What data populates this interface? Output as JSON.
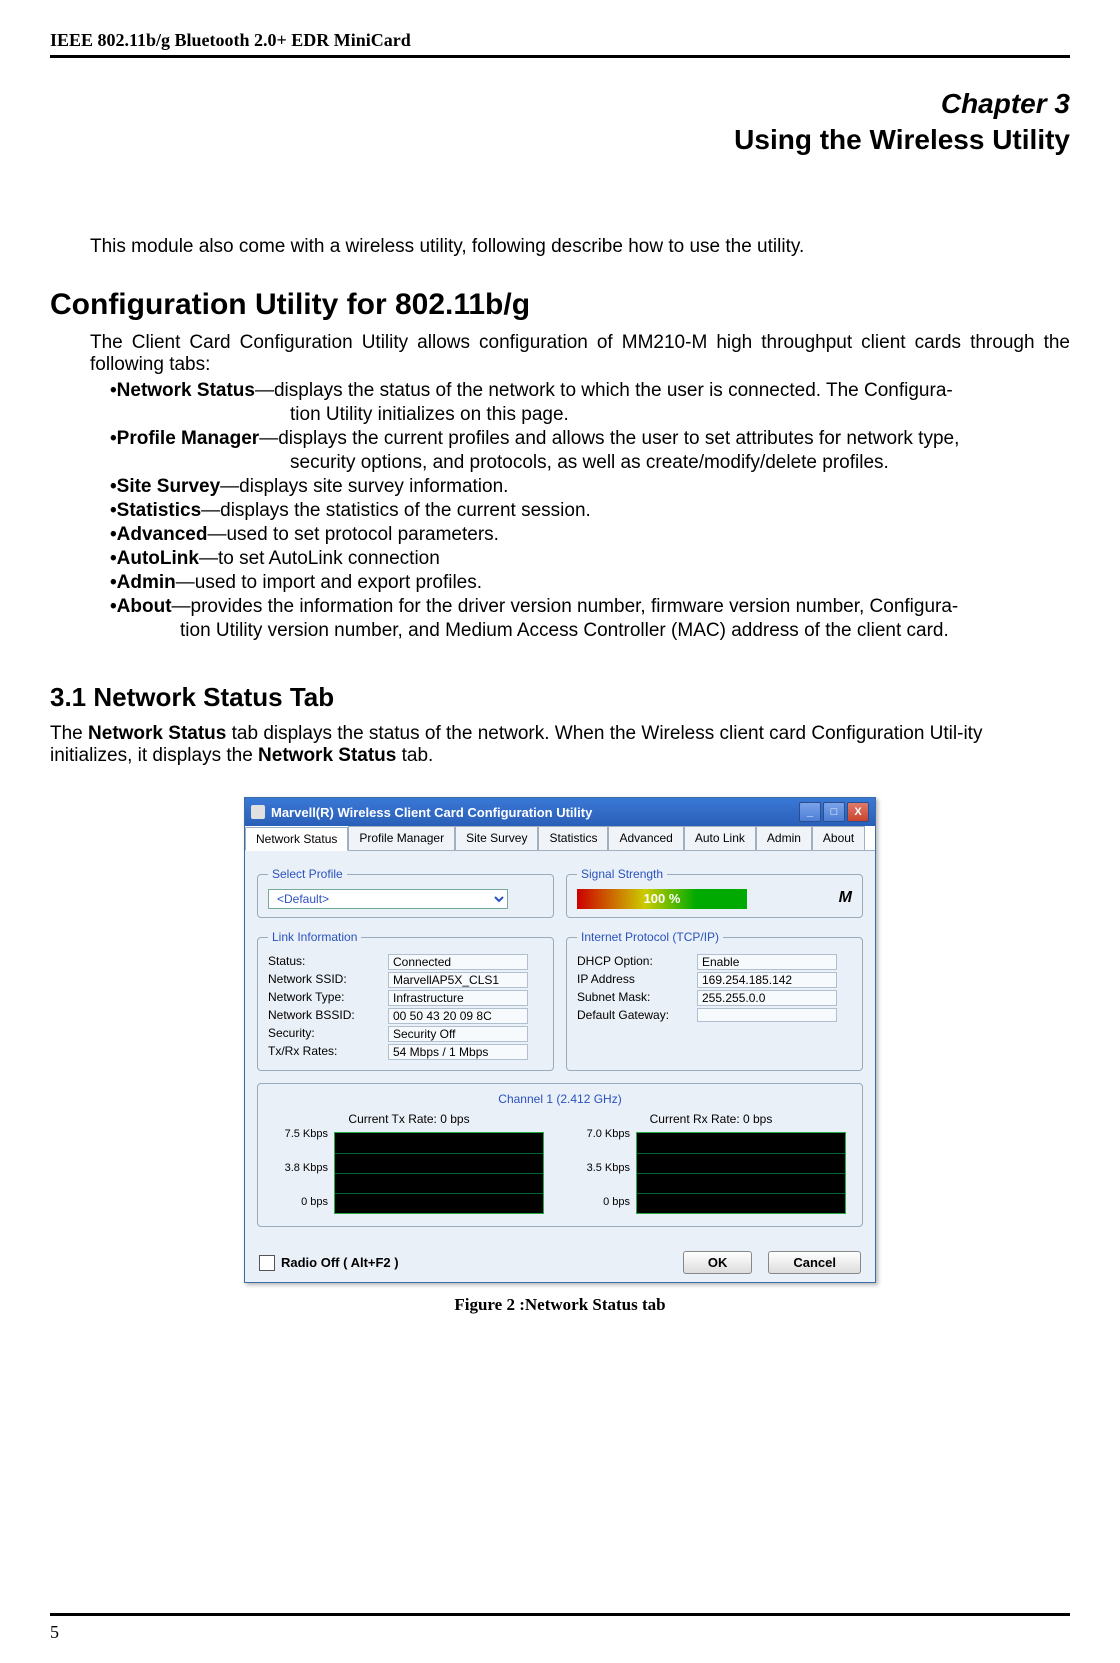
{
  "header": "IEEE 802.11b/g Bluetooth 2.0+ EDR MiniCard",
  "chapter": "Chapter 3",
  "chapter_title": "Using the Wireless Utility",
  "intro": "This module also come with a wireless utility, following describe how to use the utility.",
  "section_config_title": "Configuration Utility for 802.11b/g",
  "config_intro": "The Client Card Configuration Utility allows configuration of MM210-M high throughput client cards through the following tabs:",
  "bullets": {
    "network_status": {
      "label": "•Network Status",
      "text": "—displays the status of the network to which the user is connected. The Configura-",
      "cont": "tion Utility initializes on this page."
    },
    "profile_manager": {
      "label": "•Profile Manager",
      "text": "—displays the current profiles and allows the user to set attributes for network type,",
      "cont": "security options, and protocols, as well as create/modify/delete profiles."
    },
    "site_survey": {
      "label": "•Site Survey",
      "text": "—displays site survey information."
    },
    "statistics": {
      "label": "•Statistics",
      "text": "—displays the statistics of the current session."
    },
    "advanced": {
      "label": "•Advanced",
      "text": "—used to set protocol parameters."
    },
    "autolink": {
      "label": "•AutoLink",
      "text": "—to set AutoLink connection"
    },
    "admin": {
      "label": "•Admin",
      "text": "—used to import and export profiles."
    },
    "about": {
      "label": "•About",
      "text": "—provides the information for the driver version number, firmware version number, Configura-",
      "cont": "tion Utility version number, and Medium Access Controller (MAC) address of the client card."
    }
  },
  "section31_title": "3.1 Network Status Tab",
  "section31_text_pre": "The ",
  "section31_bold1": "Network Status",
  "section31_text_mid": " tab displays the status of the network. When the Wireless client card Configuration Util-ity initializes, it displays the ",
  "section31_bold2": "Network Status",
  "section31_text_post": " tab.",
  "figure_caption": "Figure 2 :Network Status tab",
  "window": {
    "title": "Marvell(R) Wireless Client Card Configuration Utility",
    "tabs": [
      "Network Status",
      "Profile Manager",
      "Site Survey",
      "Statistics",
      "Advanced",
      "Auto Link",
      "Admin",
      "About"
    ],
    "select_profile_legend": "Select Profile",
    "select_profile_value": "<Default>",
    "signal_legend": "Signal Strength",
    "signal_value": "100 %",
    "link_info_legend": "Link Information",
    "link": {
      "status_k": "Status:",
      "status_v": "Connected",
      "ssid_k": "Network SSID:",
      "ssid_v": "MarvellAP5X_CLS1",
      "type_k": "Network Type:",
      "type_v": "Infrastructure",
      "bssid_k": "Network BSSID:",
      "bssid_v": "00 50 43 20 09 8C",
      "sec_k": "Security:",
      "sec_v": "Security Off",
      "rate_k": "Tx/Rx Rates:",
      "rate_v": "54 Mbps / 1 Mbps"
    },
    "ip_legend": "Internet Protocol (TCP/IP)",
    "ip": {
      "dhcp_k": "DHCP Option:",
      "dhcp_v": "Enable",
      "ip_k": "IP Address",
      "ip_v": "169.254.185.142",
      "mask_k": "Subnet Mask:",
      "mask_v": "255.255.0.0",
      "gw_k": "Default Gateway:",
      "gw_v": ""
    },
    "channel_label": "Channel 1 (2.412 GHz)",
    "tx_title": "Current Tx Rate: 0 bps",
    "rx_title": "Current Rx Rate: 0 bps",
    "ylabels_tx": [
      "7.5 Kbps",
      "3.8 Kbps",
      "0 bps"
    ],
    "ylabels_rx": [
      "7.0 Kbps",
      "3.5 Kbps",
      "0 bps"
    ],
    "radio_off": "Radio Off  ( Alt+F2 )",
    "ok": "OK",
    "cancel": "Cancel"
  },
  "page_number": "5"
}
